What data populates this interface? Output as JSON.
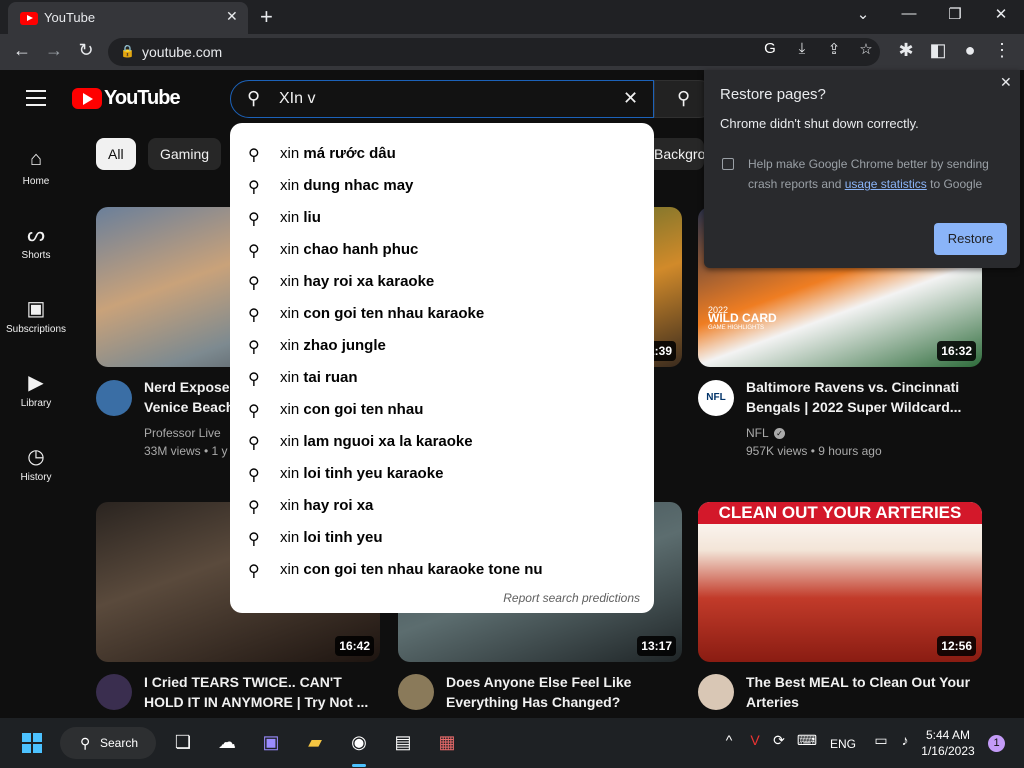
{
  "browser": {
    "tab_title": "YouTube",
    "url": "youtube.com"
  },
  "youtube": {
    "logo_text": "YouTube",
    "search": {
      "query": "XIn v"
    },
    "sidebar": [
      {
        "label": "Home",
        "icon": "home-icon"
      },
      {
        "label": "Shorts",
        "icon": "shorts-icon"
      },
      {
        "label": "Subscriptions",
        "icon": "subscriptions-icon"
      },
      {
        "label": "Library",
        "icon": "library-icon"
      },
      {
        "label": "History",
        "icon": "history-icon"
      }
    ],
    "chips": [
      "All",
      "Gaming",
      "Backgro"
    ],
    "suggestions": [
      {
        "prefix": "xin",
        "rest": "má rước dâu"
      },
      {
        "prefix": "xin",
        "rest": "dung nhac may"
      },
      {
        "prefix": "xin",
        "rest": "liu"
      },
      {
        "prefix": "xin",
        "rest": "chao hanh phuc"
      },
      {
        "prefix": "xin",
        "rest": "hay roi xa karaoke"
      },
      {
        "prefix": "xin",
        "rest": "con goi ten nhau karaoke"
      },
      {
        "prefix": "xin",
        "rest": "zhao jungle"
      },
      {
        "prefix": "xin",
        "rest": "tai ruan"
      },
      {
        "prefix": "xin",
        "rest": "con goi ten nhau"
      },
      {
        "prefix": "xin",
        "rest": "lam nguoi xa la karaoke"
      },
      {
        "prefix": "xin",
        "rest": "loi tinh yeu karaoke"
      },
      {
        "prefix": "xin",
        "rest": "hay roi xa"
      },
      {
        "prefix": "xin",
        "rest": "loi tinh yeu"
      },
      {
        "prefix": "xin",
        "rest": "con goi ten nhau karaoke tone nu"
      }
    ],
    "report_label": "Report search predictions",
    "videos": [
      {
        "title_line1": "Nerd Exposes",
        "title_line2": "Venice Beach",
        "channel": "Professor Live",
        "meta": "33M views • 1 y",
        "duration": ""
      },
      {
        "title_line1": "",
        "title_line2": "",
        "channel": "",
        "meta": "",
        "duration": "2:39"
      },
      {
        "title_line1": "Baltimore Ravens vs. Cincinnati",
        "title_line2": "Bengals | 2022 Super Wildcard...",
        "channel": "NFL",
        "meta": "957K views • 9 hours ago",
        "duration": "16:32",
        "thumb_text1": "2022",
        "thumb_text2": "WILD CARD",
        "thumb_text3": "GAME HIGHLIGHTS",
        "avatar_text": "NFL"
      },
      {
        "title_line1": "I Cried TEARS TWICE.. CAN'T",
        "title_line2": "HOLD IT IN ANYMORE | Try Not ...",
        "duration": "16:42"
      },
      {
        "title_line1": "Does Anyone Else Feel Like",
        "title_line2": "Everything Has Changed?",
        "duration": "13:17"
      },
      {
        "title_line1": "The Best MEAL to Clean Out Your",
        "title_line2": "Arteries",
        "duration": "12:56",
        "thumb_text": "CLEAN OUT YOUR ARTERIES"
      }
    ]
  },
  "restore_popup": {
    "title": "Restore pages?",
    "message": "Chrome didn't shut down correctly.",
    "help_text_before": "Help make Google Chrome better by sending crash reports and",
    "help_link": "usage statistics",
    "help_text_after": "to Google",
    "button": "Restore"
  },
  "taskbar": {
    "search_label": "Search",
    "language": "ENG",
    "time": "5:44 AM",
    "date": "1/16/2023",
    "notification_count": "1"
  },
  "colors": {
    "yt_red": "#ff0000",
    "accent_blue": "#8ab4f8",
    "focus_border": "#1c62b9"
  }
}
